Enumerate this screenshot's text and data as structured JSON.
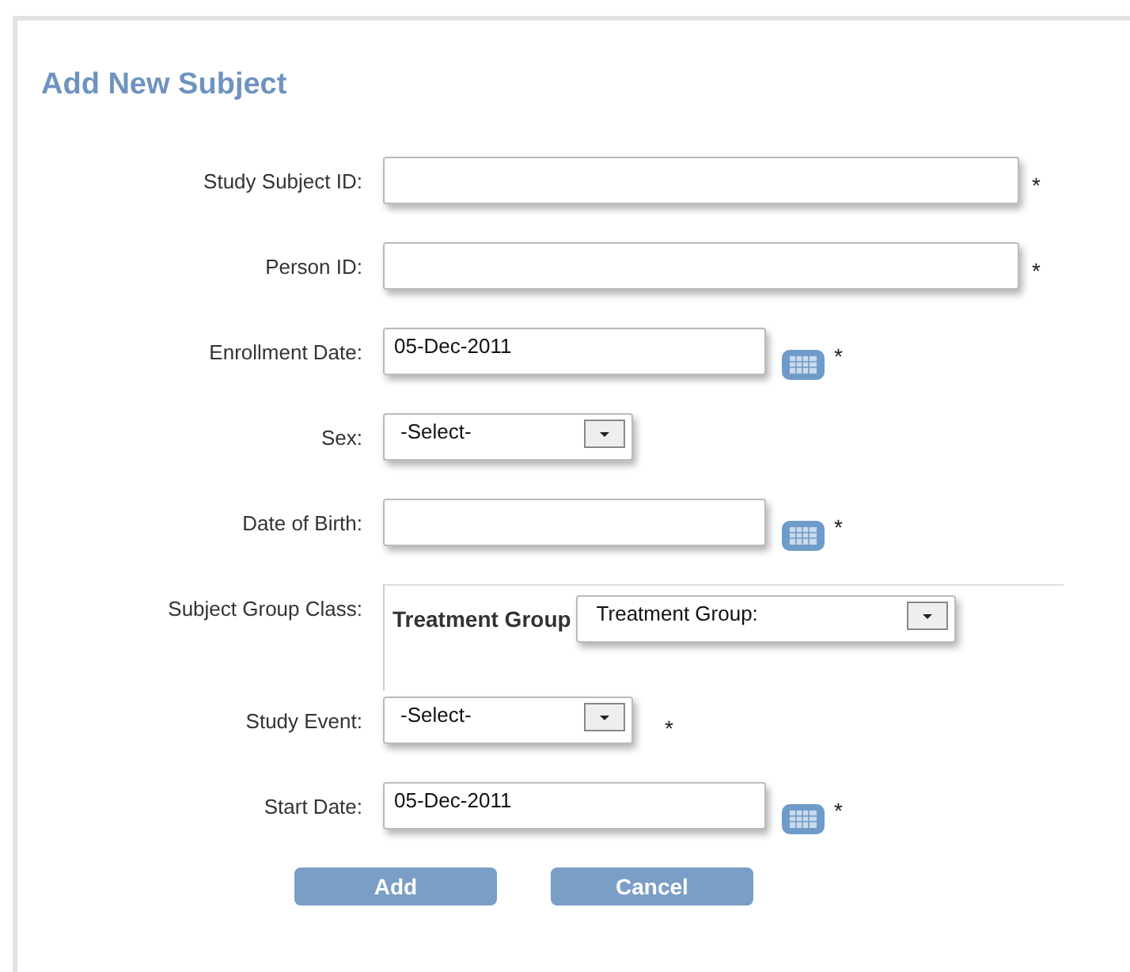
{
  "title": "Add New Subject",
  "fields": [
    {
      "kind": "text",
      "label": "Study Subject ID:",
      "marker": "*"
    },
    {
      "kind": "text",
      "label": "Person ID:",
      "marker": "*"
    },
    {
      "kind": "date",
      "label": "Enrollment Date:",
      "value": "05-Dec-2011",
      "marker": "*"
    },
    {
      "kind": "select",
      "label": "Sex:",
      "value": "-Select-"
    },
    {
      "kind": "date",
      "label": "Date of Birth:",
      "marker": "*"
    },
    {
      "kind": "group",
      "label": "Subject Group Class:",
      "group_name": "Treatment Group",
      "value": "Treatment Group:"
    },
    {
      "kind": "select",
      "label": "Study Event:",
      "value": "-Select-",
      "marker": "*"
    },
    {
      "kind": "date",
      "label": "Start Date:",
      "value": "05-Dec-2011",
      "marker": "*"
    }
  ],
  "buttons": [
    "Add",
    "Cancel"
  ]
}
